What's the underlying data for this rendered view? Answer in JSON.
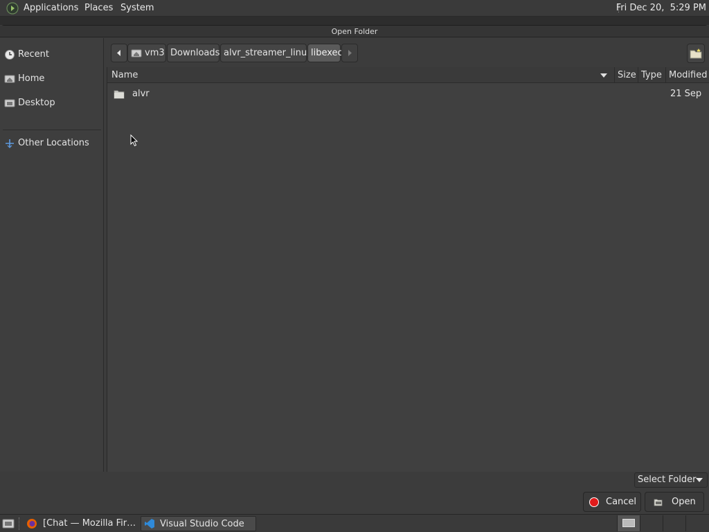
{
  "top_panel": {
    "menus": [
      "Applications",
      "Places",
      "System"
    ],
    "clock": "Fri Dec 20,  5:29 PM"
  },
  "dialog": {
    "title": "Open Folder"
  },
  "sidebar": {
    "items": [
      {
        "label": "Recent",
        "icon": "clock-icon"
      },
      {
        "label": "Home",
        "icon": "home-icon"
      },
      {
        "label": "Desktop",
        "icon": "desktop-icon"
      },
      {
        "label": "Other Locations",
        "icon": "plus-icon"
      }
    ]
  },
  "pathbar": {
    "crumbs": [
      "vm3",
      "Downloads",
      "alvr_streamer_linux",
      "libexec"
    ],
    "active_index": 3
  },
  "file_list": {
    "columns": [
      "Name",
      "Size",
      "Type",
      "Modified"
    ],
    "rows": [
      {
        "name": "alvr",
        "size": "",
        "type": "",
        "modified": "21 Sep",
        "icon": "folder-icon"
      }
    ]
  },
  "footer": {
    "filter_label": "Select Folder",
    "cancel_label": "Cancel",
    "open_label": "Open"
  },
  "taskbar": {
    "tasks": [
      {
        "label": "[Chat — Mozilla Fir…",
        "icon": "firefox-icon"
      },
      {
        "label": "Visual Studio Code",
        "icon": "vscode-icon"
      }
    ]
  },
  "colors": {
    "cancel_red": "#e01b1b",
    "active_crumb": "#5a5a5a",
    "vscode_blue": "#2f8ad9",
    "firefox_orange": "#e66000"
  }
}
